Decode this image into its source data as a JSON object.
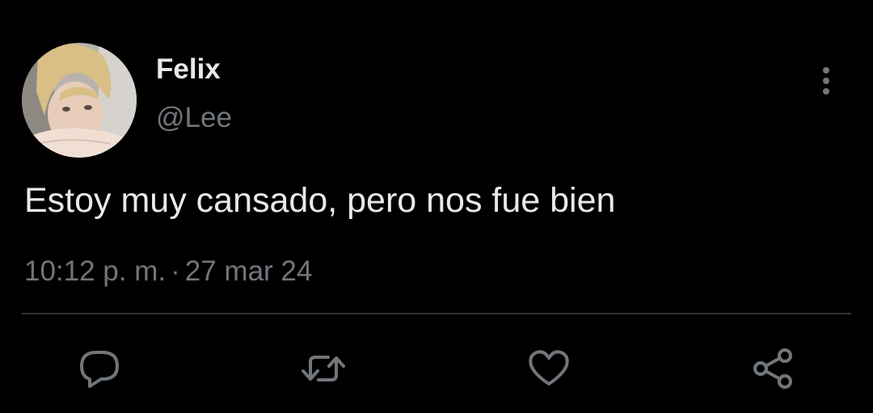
{
  "author": {
    "display_name": "Felix",
    "handle": "@Lee"
  },
  "tweet": {
    "text": "Estoy muy cansado, pero nos fue bien",
    "time": "10:12 p. m.",
    "separator": "·",
    "date": "27 mar 24"
  },
  "icons": {
    "more": "more-vertical-icon",
    "reply": "reply-icon",
    "retweet": "retweet-icon",
    "like": "heart-icon",
    "share": "share-icon"
  },
  "colors": {
    "background": "#000000",
    "primary_text": "#e7e9ea",
    "secondary_text": "#71767b",
    "divider": "#2f3336"
  }
}
